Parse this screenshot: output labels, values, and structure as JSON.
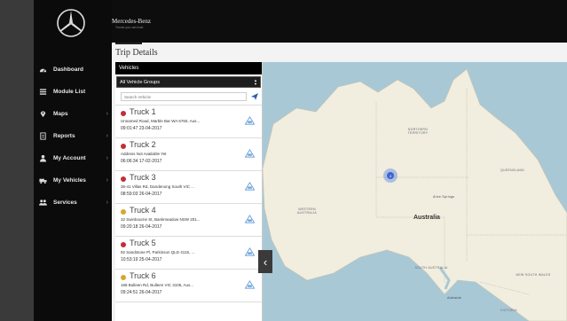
{
  "app": {
    "brand": "Mercedes-Benz",
    "tagline": "Trucks you can trust"
  },
  "sidebar": {
    "items": [
      {
        "label": "Dashboard",
        "icon": "dashboard-icon"
      },
      {
        "label": "Module List",
        "icon": "list-icon"
      },
      {
        "label": "Maps",
        "icon": "map-pin-icon"
      },
      {
        "label": "Reports",
        "icon": "report-icon"
      },
      {
        "label": "My Account",
        "icon": "user-icon"
      },
      {
        "label": "My Vehicles",
        "icon": "truck-icon"
      },
      {
        "label": "Services",
        "icon": "group-icon"
      }
    ]
  },
  "page": {
    "title": "Trip Details"
  },
  "panel": {
    "header": "Vehicles",
    "group_select": "All Vehicle Groups",
    "search_placeholder": "Search Vehicle"
  },
  "vehicles": [
    {
      "name": "Truck 1",
      "address": "Unnamed Road, Marble Bar WA 6760, Aus...",
      "time": "09:01:47 23-04-2017",
      "status_color": "#c0303a"
    },
    {
      "name": "Truck 2",
      "address": "Address Not Available Yet",
      "time": "06:06:34 17-02-2017",
      "status_color": "#c0303a"
    },
    {
      "name": "Truck 3",
      "address": "35-41 Villas Rd, Dandenong South VIC ...",
      "time": "08:59:03 26-04-2017",
      "status_color": "#c0303a"
    },
    {
      "name": "Truck 4",
      "address": "32 Swinbourne St, Bankmeadow NSW 201...",
      "time": "09:20:18 26-04-2017",
      "status_color": "#d9a62e"
    },
    {
      "name": "Truck 5",
      "address": "92 Sandstone Pl, Parkinson QLD 4115, ...",
      "time": "10:53:19 25-04-2017",
      "status_color": "#c0303a"
    },
    {
      "name": "Truck 6",
      "address": "168 Bulleen Rd, Bulleen VIC 3105, Aus...",
      "time": "09:24:51 26-04-2017",
      "status_color": "#d9a62e"
    }
  ],
  "map": {
    "country_label": "Australia",
    "regions": [
      "NORTHERN TERRITORY",
      "QUEENSLAND",
      "WESTERN AUSTRALIA",
      "SOUTH AUSTRALIA",
      "NEW SOUTH WALES",
      "VICTORIA"
    ],
    "cities": [
      "Alice Springs",
      "Adelaide"
    ],
    "cluster_count": "4",
    "land_color": "#f1eedf",
    "water_color": "#a8c8d6"
  }
}
